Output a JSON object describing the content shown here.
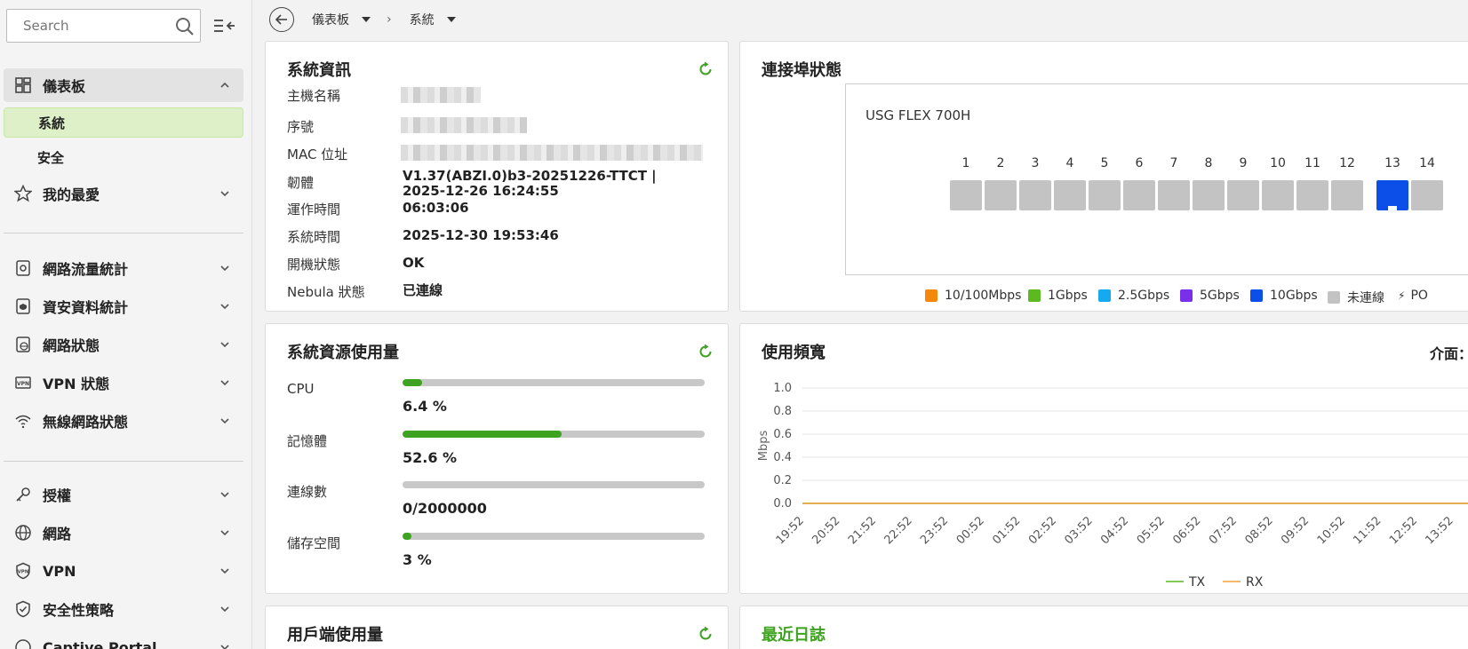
{
  "search": {
    "placeholder": "Search"
  },
  "sidebar": {
    "items": [
      {
        "label": "儀表板"
      },
      {
        "label": "系統"
      },
      {
        "label": "安全"
      },
      {
        "label": "我的最愛"
      },
      {
        "label": "網路流量統計"
      },
      {
        "label": "資安資料統計"
      },
      {
        "label": "網路狀態"
      },
      {
        "label": "VPN 狀態"
      },
      {
        "label": "無線網路狀態"
      },
      {
        "label": "授權"
      },
      {
        "label": "網路"
      },
      {
        "label": "VPN"
      },
      {
        "label": "安全性策略"
      },
      {
        "label": "Captive Portal"
      }
    ]
  },
  "breadcrumb": {
    "first": "儀表板",
    "second": "系統"
  },
  "system_info": {
    "title": "系統資訊",
    "rows": [
      {
        "label": "主機名稱"
      },
      {
        "label": "序號"
      },
      {
        "label": "MAC 位址"
      },
      {
        "label": "韌體",
        "value": "V1.37(ABZI.0)b3-20251226-TTCT |",
        "value2": "2025-12-26 16:24:55"
      },
      {
        "label": "運作時間",
        "value": "06:03:06"
      },
      {
        "label": "系統時間",
        "value": "2025-12-30 19:53:46"
      },
      {
        "label": "開機狀態",
        "value": "OK"
      },
      {
        "label": "Nebula 狀態",
        "value": "已連線"
      }
    ]
  },
  "resources": {
    "title": "系統資源使用量",
    "items": [
      {
        "label": "CPU",
        "value": "6.4 %",
        "fraction": 0.064
      },
      {
        "label": "記憶體",
        "value": "52.6 %",
        "fraction": 0.526
      },
      {
        "label": "連線數",
        "value": "0/2000000",
        "fraction": 0
      },
      {
        "label": "儲存空間",
        "value": "3 %",
        "fraction": 0.03
      }
    ]
  },
  "ports": {
    "title": "連接埠狀態",
    "model": "USG FLEX 700H",
    "numbers": [
      "1",
      "2",
      "3",
      "4",
      "5",
      "6",
      "7",
      "8",
      "9",
      "10",
      "11",
      "12",
      "13",
      "14"
    ],
    "legend": [
      {
        "label": "10/100Mbps",
        "color": "#f5870a"
      },
      {
        "label": "1Gbps",
        "color": "#5cb91f"
      },
      {
        "label": "2.5Gbps",
        "color": "#17a9ef"
      },
      {
        "label": "5Gbps",
        "color": "#7a2fe8"
      },
      {
        "label": "10Gbps",
        "color": "#0b4fe8"
      },
      {
        "label": "未連線",
        "color": "#c3c3c3"
      },
      {
        "label": "PO"
      }
    ]
  },
  "bandwidth": {
    "title": "使用頻寬",
    "interface_label": "介面："
  },
  "chart_data": {
    "type": "line",
    "xlabel": "",
    "ylabel": "Mbps",
    "ylim": [
      0,
      1.0
    ],
    "yticks": [
      "1.0",
      "0.8",
      "0.6",
      "0.4",
      "0.2",
      "0.0"
    ],
    "x": [
      "19:52",
      "20:52",
      "21:52",
      "22:52",
      "23:52",
      "00:52",
      "01:52",
      "02:52",
      "03:52",
      "04:52",
      "05:52",
      "06:52",
      "07:52",
      "08:52",
      "09:52",
      "10:52",
      "11:52",
      "12:52",
      "13:52"
    ],
    "series": [
      {
        "name": "TX",
        "color": "#5cb91f",
        "values": [
          0,
          0,
          0,
          0,
          0,
          0,
          0,
          0,
          0,
          0,
          0,
          0,
          0,
          0,
          0,
          0,
          0,
          0,
          0
        ]
      },
      {
        "name": "RX",
        "color": "#f5a03c",
        "values": [
          0,
          0,
          0,
          0,
          0,
          0,
          0,
          0,
          0,
          0,
          0,
          0,
          0,
          0,
          0,
          0,
          0,
          0,
          0
        ]
      }
    ],
    "grid": true,
    "legend": "bottom"
  },
  "client_usage": {
    "title": "用戶端使用量"
  },
  "recent_logs": {
    "title": "最近日誌",
    "color": "#3ea320"
  }
}
